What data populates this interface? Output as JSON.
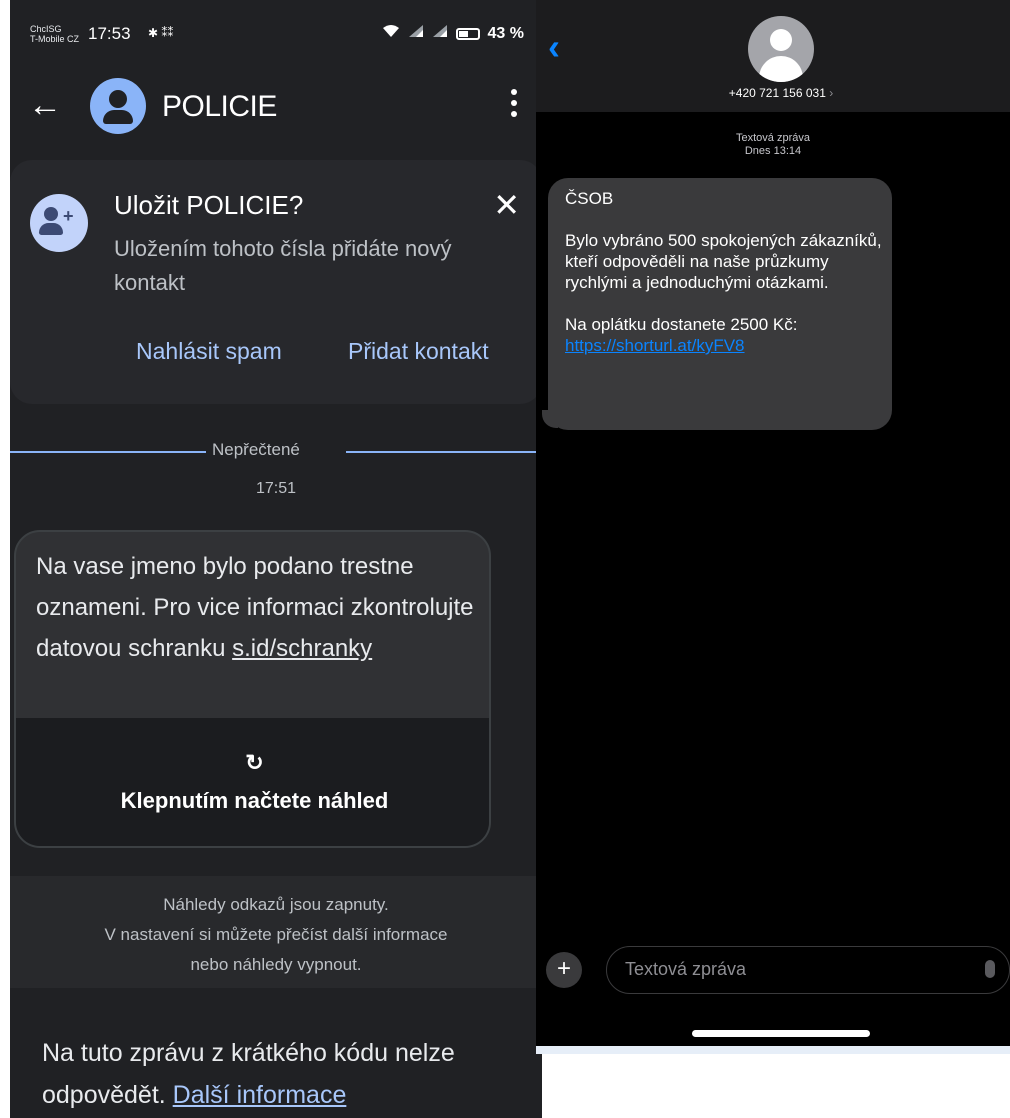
{
  "left": {
    "status": {
      "carrier_line1": "ChcISG",
      "carrier_line2": "T-Mobile CZ",
      "time": "17:53",
      "icons": "✱ ⁑⁑",
      "battery": "43 %"
    },
    "appbar": {
      "back_icon": "←",
      "contact_name": "POLICIE",
      "menu_icon": "⋮"
    },
    "save_card": {
      "title": "Uložit POLICIE?",
      "description": "Uložením tohoto čísla přidáte nový kontakt",
      "close_icon": "✕",
      "spam_label": "Nahlásit spam",
      "add_label": "Přidat kontakt"
    },
    "divider_label": "Nepřečtené",
    "time_label": "17:51",
    "message": {
      "text": "Na vase jmeno bylo podano trestne oznameni. Pro vice informaci zkontrolujte datovou schranku ",
      "link": "s.id/schranky",
      "reload_icon": "↻",
      "preview_label": "Klepnutím načtete náhled"
    },
    "info": {
      "line1": "Náhledy odkazů jsou zapnuty.",
      "line2": "V nastavení si můžete přečíst další informace",
      "line3": "nebo náhledy vypnout."
    },
    "footer": {
      "text": "Na tuto zprávu z krátkého kódu nelze odpovědět. ",
      "link": "Další informace"
    }
  },
  "right": {
    "back_icon": "‹",
    "phone_number": "+420 721 156 031",
    "number_chevron": "›",
    "meta_line1": "Textová zpráva",
    "meta_line2": "Dnes 13:14",
    "message": {
      "text": "ČSOB\n\nBylo vybráno 500 spokojených zákazníků, kteří odpověděli na naše průzkumy rychlými a jednoduchými otázkami.\n\nNa oplátku dostanete 2500 Kč:\n",
      "link": "https://shorturl.at/kyFV8"
    },
    "plus_icon": "+",
    "input_placeholder": "Textová zpráva"
  },
  "colors": {
    "android_bg": "#202124",
    "accent_blue": "#8ab4f8",
    "ios_bubble": "#3a3a3c",
    "ios_link": "#0a84ff"
  }
}
